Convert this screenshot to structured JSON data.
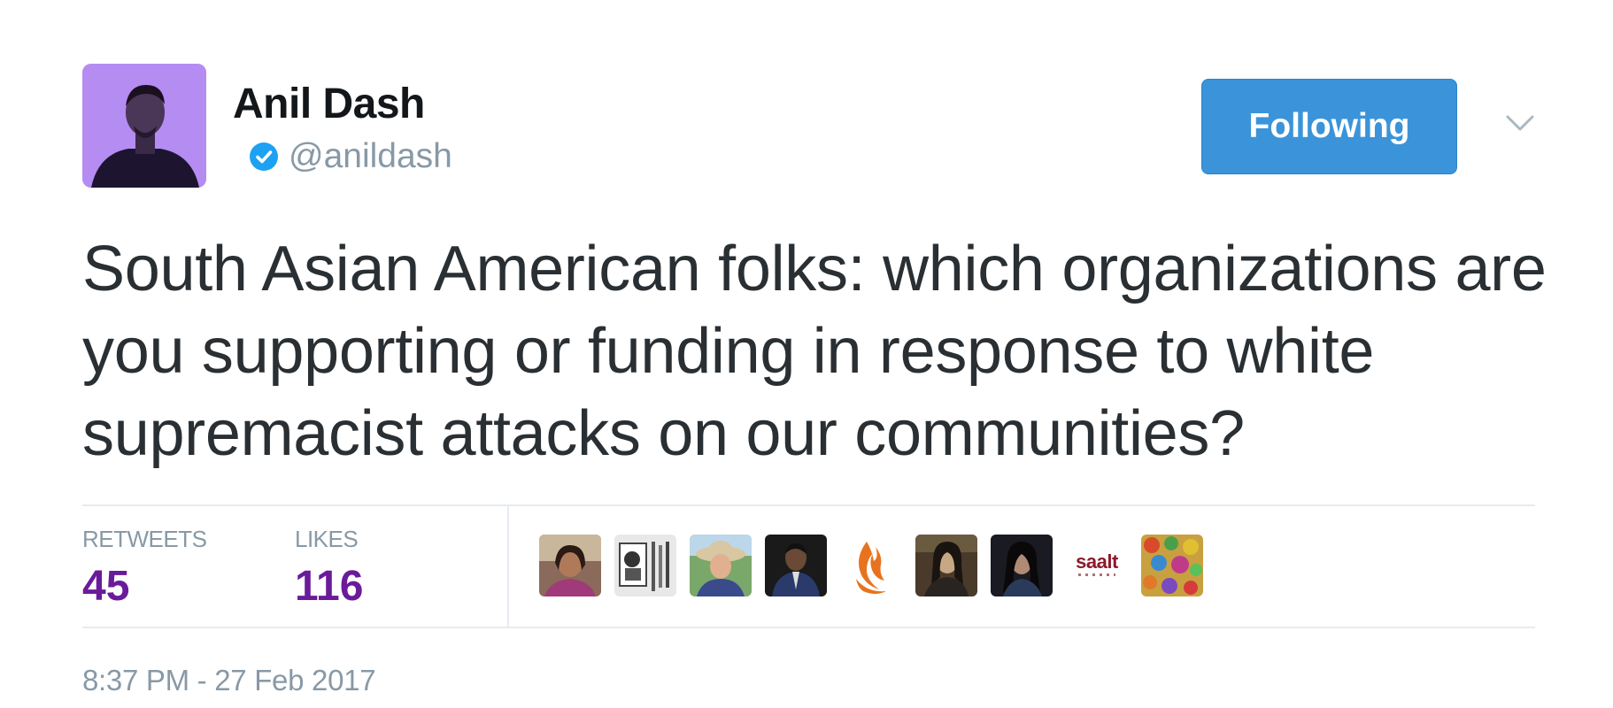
{
  "author": {
    "name": "Anil Dash",
    "handle": "@anildash",
    "verified": true,
    "avatar_icon": "profile-photo"
  },
  "follow_button": {
    "label": "Following",
    "color": "#3b94d9"
  },
  "menu_icon": "chevron-down-icon",
  "tweet": {
    "text": "South Asian American folks: which organizations are you supporting or funding in response to white supremacist attacks on our communities?"
  },
  "stats": {
    "retweets_label": "RETWEETS",
    "retweets_count": "45",
    "likes_label": "LIKES",
    "likes_count": "116",
    "count_color": "#6a1b9a"
  },
  "likers": {
    "saalt_text": "saalt"
  },
  "timestamp": "8:37 PM - 27 Feb 2017"
}
